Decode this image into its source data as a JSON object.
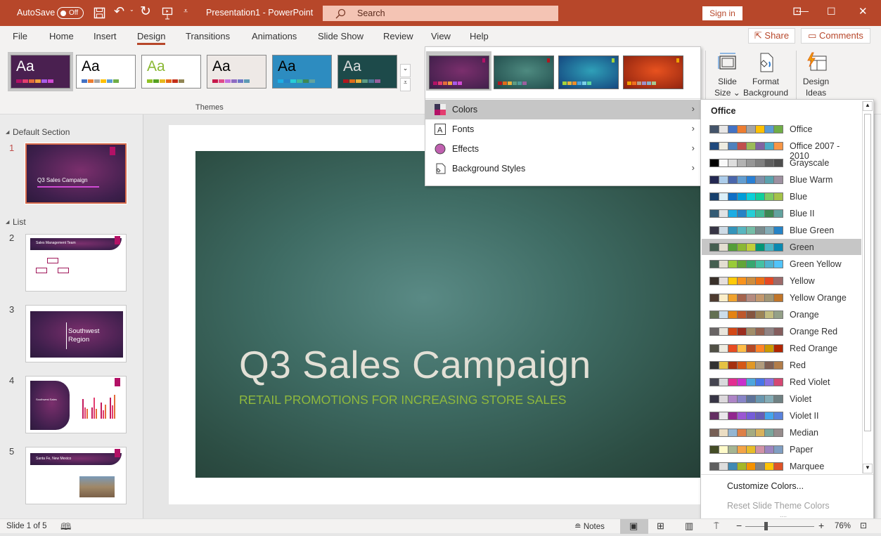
{
  "titlebar": {
    "autosave_label": "AutoSave",
    "autosave_state": "Off",
    "doc_title": "Presentation1  -  PowerPoint",
    "search_placeholder": "Search",
    "signin": "Sign in",
    "accent": "#b7472a"
  },
  "tabs": [
    {
      "label": "File"
    },
    {
      "label": "Home"
    },
    {
      "label": "Insert"
    },
    {
      "label": "Design",
      "active": true
    },
    {
      "label": "Transitions"
    },
    {
      "label": "Animations"
    },
    {
      "label": "Slide Show"
    },
    {
      "label": "Review"
    },
    {
      "label": "View"
    },
    {
      "label": "Help"
    }
  ],
  "share": "Share",
  "comments": "Comments",
  "ribbon": {
    "themes_label": "Themes",
    "themes": [
      {
        "aa": "Aa",
        "bg": "#4a2050",
        "fg": "#fff",
        "colors": [
          "#b31166",
          "#e33d6f",
          "#e46c3a",
          "#f0a33e",
          "#a65be8",
          "#d04ad4"
        ]
      },
      {
        "aa": "Aa",
        "bg": "#ffffff",
        "fg": "#000",
        "colors": [
          "#4472c4",
          "#ed7d31",
          "#a5a5a5",
          "#ffc000",
          "#5b9bd5",
          "#70ad47"
        ]
      },
      {
        "aa": "Aa",
        "bg": "#ffffff",
        "fg": "#8ab833",
        "colors": [
          "#90c226",
          "#54a021",
          "#e6b91e",
          "#e76618",
          "#c42f1a",
          "#918655"
        ]
      },
      {
        "aa": "Aa",
        "bg": "#eee9e6",
        "fg": "#000",
        "colors": [
          "#c6184a",
          "#e04b8a",
          "#c170e0",
          "#8e6bc2",
          "#6d78c8",
          "#5e9ab4"
        ]
      },
      {
        "aa": "Aa",
        "bg": "#2d8cc0",
        "fg": "#000",
        "colors": [
          "#1cade4",
          "#2683c6",
          "#27ced7",
          "#42ba97",
          "#3e8853",
          "#62a39f"
        ]
      },
      {
        "aa": "Aa",
        "bg": "#1d4a4a",
        "fg": "#ddd",
        "colors": [
          "#b0171f",
          "#e06c1a",
          "#e8b23c",
          "#5d9c83",
          "#4e7a9a",
          "#9b5f9e"
        ]
      }
    ],
    "slide_size": [
      "Slide",
      "Size"
    ],
    "format_background": [
      "Format",
      "Background"
    ],
    "design_ideas": [
      "Design",
      "Ideas"
    ]
  },
  "variants": [
    {
      "bg": "radial-gradient(ellipse at 55% 45%,#7b2f6d,#3b1e48)",
      "tag": "#b31166",
      "colors": [
        "#b31166",
        "#e33d6f",
        "#e46c3a",
        "#f0a33e",
        "#a65be8",
        "#d04ad4"
      ]
    },
    {
      "bg": "radial-gradient(ellipse at 55% 45%,#4e8a80,#1f4a4a)",
      "tag": "#b0171f",
      "colors": [
        "#b0171f",
        "#e06c1a",
        "#e8b23c",
        "#5d9c83",
        "#4e9a9a",
        "#9b5f9e"
      ]
    },
    {
      "bg": "radial-gradient(ellipse at 55% 45%,#2fa0b8,#123f7a)",
      "tag": "#a5d23a",
      "colors": [
        "#a5d23a",
        "#e8b23c",
        "#f08c2a",
        "#4ea6dc",
        "#7ad0e6",
        "#5cd6a0"
      ]
    },
    {
      "bg": "radial-gradient(ellipse at 55% 45%,#e8521f,#8a200e)",
      "tag": "#f0a000",
      "colors": [
        "#f0a000",
        "#f07020",
        "#b8a088",
        "#a090c8",
        "#88b0c8",
        "#a8c890"
      ]
    }
  ],
  "menu": [
    {
      "label": "Colors",
      "icon": "colors-icon"
    },
    {
      "label": "Fonts",
      "icon": "fonts-icon"
    },
    {
      "label": "Effects",
      "icon": "effects-icon"
    },
    {
      "label": "Background Styles",
      "icon": "background-styles-icon"
    }
  ],
  "colors_menu": {
    "heading": "Office",
    "highlighted": "Green",
    "schemes": [
      {
        "name": "Office",
        "swatches": [
          "#44546a",
          "#e7e6e6",
          "#4472c4",
          "#ed7d31",
          "#a5a5a5",
          "#ffc000",
          "#5b9bd5",
          "#70ad47"
        ]
      },
      {
        "name": "Office 2007 - 2010",
        "swatches": [
          "#1f497d",
          "#eeece1",
          "#4f81bd",
          "#c0504d",
          "#9bbb59",
          "#8064a2",
          "#4bacc6",
          "#f79646"
        ]
      },
      {
        "name": "Grayscale",
        "swatches": [
          "#000000",
          "#f8f8f8",
          "#dddddd",
          "#b2b2b2",
          "#969696",
          "#808080",
          "#5f5f5f",
          "#4d4d4d"
        ]
      },
      {
        "name": "Blue Warm",
        "swatches": [
          "#242852",
          "#acccea",
          "#4a66ac",
          "#629dd1",
          "#297fd5",
          "#7f8fa9",
          "#5aa2ae",
          "#9d90a0"
        ]
      },
      {
        "name": "Blue",
        "swatches": [
          "#17406d",
          "#dbeff9",
          "#0f6fc6",
          "#009dd9",
          "#0bd0d9",
          "#10cf9b",
          "#7cca62",
          "#a5c249"
        ]
      },
      {
        "name": "Blue II",
        "swatches": [
          "#335b74",
          "#dfe3e5",
          "#1cade4",
          "#2683c6",
          "#27ced7",
          "#42ba97",
          "#3e8853",
          "#62a39f"
        ]
      },
      {
        "name": "Blue Green",
        "swatches": [
          "#373545",
          "#cedbe6",
          "#3494ba",
          "#58b6c0",
          "#75bda7",
          "#7a8c8e",
          "#84acb6",
          "#2683c6"
        ]
      },
      {
        "name": "Green",
        "swatches": [
          "#455f51",
          "#e3ded1",
          "#549e39",
          "#8ab833",
          "#c0cf3a",
          "#029676",
          "#4ab5c4",
          "#0989b1"
        ]
      },
      {
        "name": "Green Yellow",
        "swatches": [
          "#455f51",
          "#e3ded1",
          "#99cb38",
          "#63a537",
          "#37a76f",
          "#44c1a3",
          "#4eb3cf",
          "#51c3f9"
        ]
      },
      {
        "name": "Yellow",
        "swatches": [
          "#39302a",
          "#e5dedb",
          "#ffca08",
          "#f8931d",
          "#ce8d3e",
          "#ec7016",
          "#e64823",
          "#9c6a6a"
        ]
      },
      {
        "name": "Yellow Orange",
        "swatches": [
          "#4e3b30",
          "#fbeec9",
          "#f0a22e",
          "#a5644e",
          "#b58b80",
          "#c3986d",
          "#a19574",
          "#c17529"
        ]
      },
      {
        "name": "Orange",
        "swatches": [
          "#637052",
          "#ccddea",
          "#e48312",
          "#bd582c",
          "#865640",
          "#9b8357",
          "#c2bc80",
          "#94a088"
        ]
      },
      {
        "name": "Orange Red",
        "swatches": [
          "#696464",
          "#e9e5dc",
          "#d34817",
          "#9b2d1f",
          "#a28e6a",
          "#956251",
          "#918485",
          "#855d5d"
        ]
      },
      {
        "name": "Red Orange",
        "swatches": [
          "#505046",
          "#eeece1",
          "#e84c22",
          "#ffbd47",
          "#b64926",
          "#ff8427",
          "#cc9900",
          "#b22600"
        ]
      },
      {
        "name": "Red",
        "swatches": [
          "#323232",
          "#e5c243",
          "#a5300f",
          "#d55816",
          "#e19825",
          "#b19c7d",
          "#7f5f52",
          "#b27d49"
        ]
      },
      {
        "name": "Red Violet",
        "swatches": [
          "#454551",
          "#d8d9dc",
          "#e32d91",
          "#c830cc",
          "#4ea6dc",
          "#4775e7",
          "#8971e1",
          "#d54773"
        ]
      },
      {
        "name": "Violet",
        "swatches": [
          "#373545",
          "#dcd8dc",
          "#ad84c6",
          "#8784c7",
          "#5d739a",
          "#6997af",
          "#84acb6",
          "#6f8183"
        ]
      },
      {
        "name": "Violet II",
        "swatches": [
          "#632e62",
          "#eae5eb",
          "#92278f",
          "#9b57d3",
          "#755dd9",
          "#665eb8",
          "#45a5ed",
          "#5982db"
        ]
      },
      {
        "name": "Median",
        "swatches": [
          "#775f55",
          "#ebddc3",
          "#94b6d2",
          "#dd8047",
          "#a5ab81",
          "#d8b25c",
          "#7ba79d",
          "#968c8c"
        ]
      },
      {
        "name": "Paper",
        "swatches": [
          "#444d26",
          "#fefac9",
          "#a5b592",
          "#f3a447",
          "#e7bc29",
          "#d092a7",
          "#9c85c0",
          "#809ec2"
        ]
      },
      {
        "name": "Marquee",
        "swatches": [
          "#5e5e5e",
          "#dddddd",
          "#418ab3",
          "#a6b727",
          "#f69200",
          "#838383",
          "#fec306",
          "#df5327"
        ]
      }
    ],
    "customize": "Customize Colors...",
    "reset": "Reset Slide Theme Colors"
  },
  "slides_pane": {
    "sections": [
      "Default Section",
      "List"
    ],
    "slides": [
      {
        "num": "1",
        "title": "Q3 Sales Campaign"
      },
      {
        "num": "2",
        "title": "Sales Management Team"
      },
      {
        "num": "3",
        "title": "Southwest Region"
      },
      {
        "num": "4",
        "title": "Southwest Sales"
      },
      {
        "num": "5",
        "title": "Santa Fe, New Mexico"
      }
    ]
  },
  "slide": {
    "title": "Q3 Sales Campaign",
    "subtitle": "RETAIL PROMOTIONS FOR INCREASING STORE SALES"
  },
  "status": {
    "slide_counter": "Slide 1 of 5",
    "notes": "Notes",
    "zoom": "76%",
    "zoom_value": 76
  }
}
